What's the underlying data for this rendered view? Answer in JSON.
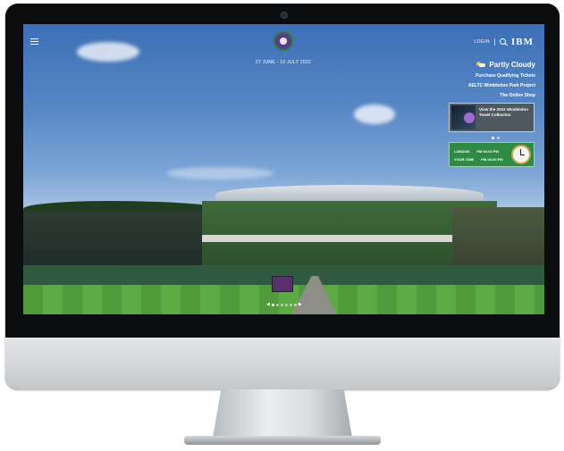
{
  "header": {
    "dates": "27 JUNE - 10 JULY 2022",
    "login_label": "LOGIN",
    "brand": "IBM"
  },
  "weather": {
    "condition": "Partly Cloudy",
    "icon": "partly-cloudy-icon"
  },
  "links": [
    "Purchase Qualifying Tickets",
    "AELTC Wimbledon Park Project",
    "The Online Shop"
  ],
  "promo": {
    "text": "View the 2022 Wimbledon Towel Collection"
  },
  "clock": {
    "row1_label": "LONDON",
    "row1_time": "PM 06:00 PM",
    "row2_label": "YOUR TIME",
    "row2_time": "PM 06:00 PM"
  },
  "carousel": {
    "left_arrow": "◀",
    "right_arrow": "▶"
  },
  "colors": {
    "accent_green": "#2f8a45",
    "brand_purple": "#5a3a8a"
  }
}
